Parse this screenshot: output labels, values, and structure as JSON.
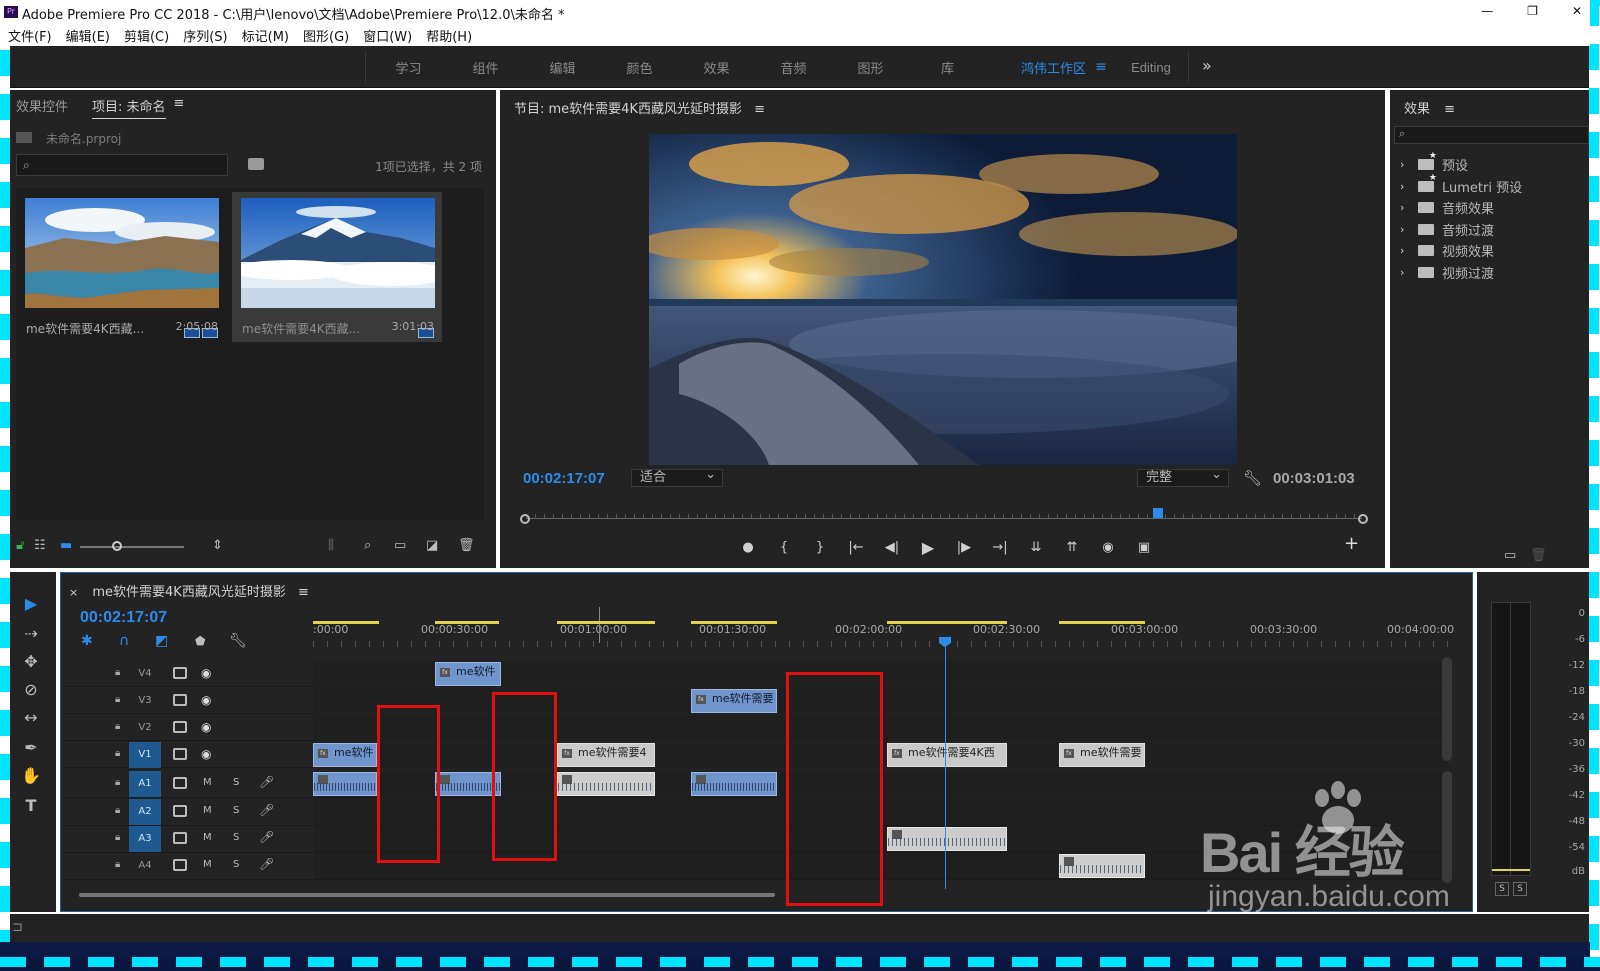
{
  "window": {
    "title": "Adobe Premiere Pro CC 2018 - C:\\用户\\lenovo\\文档\\Adobe\\Premiere Pro\\12.0\\未命名 *",
    "controls": [
      "—",
      "❐",
      "✕"
    ]
  },
  "menubar": [
    "文件(F)",
    "编辑(E)",
    "剪辑(C)",
    "序列(S)",
    "标记(M)",
    "图形(G)",
    "窗口(W)",
    "帮助(H)"
  ],
  "workspaces": {
    "tabs": [
      "学习",
      "组件",
      "编辑",
      "颜色",
      "效果",
      "音频",
      "图形",
      "库"
    ],
    "active": "鸿伟工作区",
    "menu_icon": "≡",
    "editing": "Editing",
    "more": "»"
  },
  "project_panel": {
    "tabs": [
      "效果控件",
      "项目: 未命名"
    ],
    "menu": "≡",
    "file": "未命名.prproj",
    "selection_info": "1项已选择，共 2 项",
    "search_icon": "⌕",
    "clips": [
      {
        "name": "me软件需要4K西藏...",
        "duration": "2:05:08"
      },
      {
        "name": "me软件需要4K西藏...",
        "duration": "3:01:03"
      }
    ]
  },
  "program_monitor": {
    "title": "节目: me软件需要4K西藏风光延时摄影",
    "menu": "≡",
    "current_tc": "00:02:17:07",
    "fit": "适合",
    "quality": "完整",
    "duration_tc": "00:03:01:03",
    "transport": [
      "●",
      "{",
      "}",
      "|←",
      "◀|",
      "▶",
      "|▶",
      "→|",
      "⇊",
      "⇈",
      "◉",
      "▣"
    ],
    "add": "+"
  },
  "effects_panel": {
    "title": "效果",
    "menu": "≡",
    "items": [
      "预设",
      "Lumetri 预设",
      "音频效果",
      "音频过渡",
      "视频效果",
      "视频过渡"
    ]
  },
  "tools": [
    "▶",
    "⇢",
    "✥",
    "⊘",
    "↔",
    "✒",
    "✋",
    "T"
  ],
  "timeline": {
    "close": "×",
    "sequence_name": "me软件需要4K西藏风光延时摄影",
    "menu": "≡",
    "current_tc": "00:02:17:07",
    "ruler": [
      ":00:00",
      "00:00:30:00",
      "00:01:00:00",
      "00:01:30:00",
      "00:02:00:00",
      "00:02:30:00",
      "00:03:00:00",
      "00:03:30:00",
      "00:04:00:00"
    ],
    "video_tracks": [
      "V4",
      "V3",
      "V2",
      "V1"
    ],
    "audio_tracks": [
      "A1",
      "A2",
      "A3",
      "A4"
    ],
    "mute_label": "M",
    "solo_label": "S",
    "clip_label_short": "me软件",
    "clip_label_mid": "me软件需要",
    "clip_label_long": "me软件需要4K西",
    "clip_label_v1c": "me软件需要4",
    "clip_label_v1e": "me软件需要",
    "fx": "fx"
  },
  "meter": {
    "levels": [
      "0",
      "-6",
      "-12",
      "-18",
      "-24",
      "-30",
      "-36",
      "-42",
      "-48",
      "-54",
      "dB"
    ],
    "solo": [
      "S",
      "S"
    ]
  },
  "watermark": {
    "brand": "Bai 经验",
    "url": "jingyan.baidu.com"
  },
  "colors": {
    "accent": "#2d8ceb",
    "panel": "#232323",
    "clip_video": "#6f95cc",
    "clip_grey": "#c9c9c9",
    "annotation": "#e01010"
  }
}
